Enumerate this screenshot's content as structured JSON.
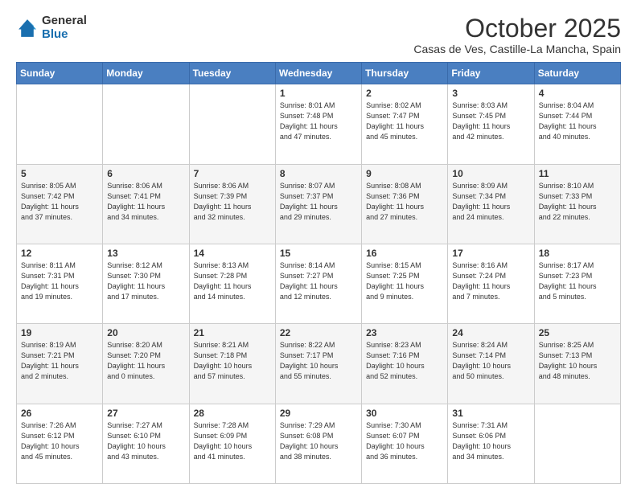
{
  "logo": {
    "general": "General",
    "blue": "Blue"
  },
  "header": {
    "month": "October 2025",
    "location": "Casas de Ves, Castille-La Mancha, Spain"
  },
  "days_of_week": [
    "Sunday",
    "Monday",
    "Tuesday",
    "Wednesday",
    "Thursday",
    "Friday",
    "Saturday"
  ],
  "weeks": [
    [
      {
        "day": "",
        "info": ""
      },
      {
        "day": "",
        "info": ""
      },
      {
        "day": "",
        "info": ""
      },
      {
        "day": "1",
        "info": "Sunrise: 8:01 AM\nSunset: 7:48 PM\nDaylight: 11 hours\nand 47 minutes."
      },
      {
        "day": "2",
        "info": "Sunrise: 8:02 AM\nSunset: 7:47 PM\nDaylight: 11 hours\nand 45 minutes."
      },
      {
        "day": "3",
        "info": "Sunrise: 8:03 AM\nSunset: 7:45 PM\nDaylight: 11 hours\nand 42 minutes."
      },
      {
        "day": "4",
        "info": "Sunrise: 8:04 AM\nSunset: 7:44 PM\nDaylight: 11 hours\nand 40 minutes."
      }
    ],
    [
      {
        "day": "5",
        "info": "Sunrise: 8:05 AM\nSunset: 7:42 PM\nDaylight: 11 hours\nand 37 minutes."
      },
      {
        "day": "6",
        "info": "Sunrise: 8:06 AM\nSunset: 7:41 PM\nDaylight: 11 hours\nand 34 minutes."
      },
      {
        "day": "7",
        "info": "Sunrise: 8:06 AM\nSunset: 7:39 PM\nDaylight: 11 hours\nand 32 minutes."
      },
      {
        "day": "8",
        "info": "Sunrise: 8:07 AM\nSunset: 7:37 PM\nDaylight: 11 hours\nand 29 minutes."
      },
      {
        "day": "9",
        "info": "Sunrise: 8:08 AM\nSunset: 7:36 PM\nDaylight: 11 hours\nand 27 minutes."
      },
      {
        "day": "10",
        "info": "Sunrise: 8:09 AM\nSunset: 7:34 PM\nDaylight: 11 hours\nand 24 minutes."
      },
      {
        "day": "11",
        "info": "Sunrise: 8:10 AM\nSunset: 7:33 PM\nDaylight: 11 hours\nand 22 minutes."
      }
    ],
    [
      {
        "day": "12",
        "info": "Sunrise: 8:11 AM\nSunset: 7:31 PM\nDaylight: 11 hours\nand 19 minutes."
      },
      {
        "day": "13",
        "info": "Sunrise: 8:12 AM\nSunset: 7:30 PM\nDaylight: 11 hours\nand 17 minutes."
      },
      {
        "day": "14",
        "info": "Sunrise: 8:13 AM\nSunset: 7:28 PM\nDaylight: 11 hours\nand 14 minutes."
      },
      {
        "day": "15",
        "info": "Sunrise: 8:14 AM\nSunset: 7:27 PM\nDaylight: 11 hours\nand 12 minutes."
      },
      {
        "day": "16",
        "info": "Sunrise: 8:15 AM\nSunset: 7:25 PM\nDaylight: 11 hours\nand 9 minutes."
      },
      {
        "day": "17",
        "info": "Sunrise: 8:16 AM\nSunset: 7:24 PM\nDaylight: 11 hours\nand 7 minutes."
      },
      {
        "day": "18",
        "info": "Sunrise: 8:17 AM\nSunset: 7:23 PM\nDaylight: 11 hours\nand 5 minutes."
      }
    ],
    [
      {
        "day": "19",
        "info": "Sunrise: 8:19 AM\nSunset: 7:21 PM\nDaylight: 11 hours\nand 2 minutes."
      },
      {
        "day": "20",
        "info": "Sunrise: 8:20 AM\nSunset: 7:20 PM\nDaylight: 11 hours\nand 0 minutes."
      },
      {
        "day": "21",
        "info": "Sunrise: 8:21 AM\nSunset: 7:18 PM\nDaylight: 10 hours\nand 57 minutes."
      },
      {
        "day": "22",
        "info": "Sunrise: 8:22 AM\nSunset: 7:17 PM\nDaylight: 10 hours\nand 55 minutes."
      },
      {
        "day": "23",
        "info": "Sunrise: 8:23 AM\nSunset: 7:16 PM\nDaylight: 10 hours\nand 52 minutes."
      },
      {
        "day": "24",
        "info": "Sunrise: 8:24 AM\nSunset: 7:14 PM\nDaylight: 10 hours\nand 50 minutes."
      },
      {
        "day": "25",
        "info": "Sunrise: 8:25 AM\nSunset: 7:13 PM\nDaylight: 10 hours\nand 48 minutes."
      }
    ],
    [
      {
        "day": "26",
        "info": "Sunrise: 7:26 AM\nSunset: 6:12 PM\nDaylight: 10 hours\nand 45 minutes."
      },
      {
        "day": "27",
        "info": "Sunrise: 7:27 AM\nSunset: 6:10 PM\nDaylight: 10 hours\nand 43 minutes."
      },
      {
        "day": "28",
        "info": "Sunrise: 7:28 AM\nSunset: 6:09 PM\nDaylight: 10 hours\nand 41 minutes."
      },
      {
        "day": "29",
        "info": "Sunrise: 7:29 AM\nSunset: 6:08 PM\nDaylight: 10 hours\nand 38 minutes."
      },
      {
        "day": "30",
        "info": "Sunrise: 7:30 AM\nSunset: 6:07 PM\nDaylight: 10 hours\nand 36 minutes."
      },
      {
        "day": "31",
        "info": "Sunrise: 7:31 AM\nSunset: 6:06 PM\nDaylight: 10 hours\nand 34 minutes."
      },
      {
        "day": "",
        "info": ""
      }
    ]
  ]
}
